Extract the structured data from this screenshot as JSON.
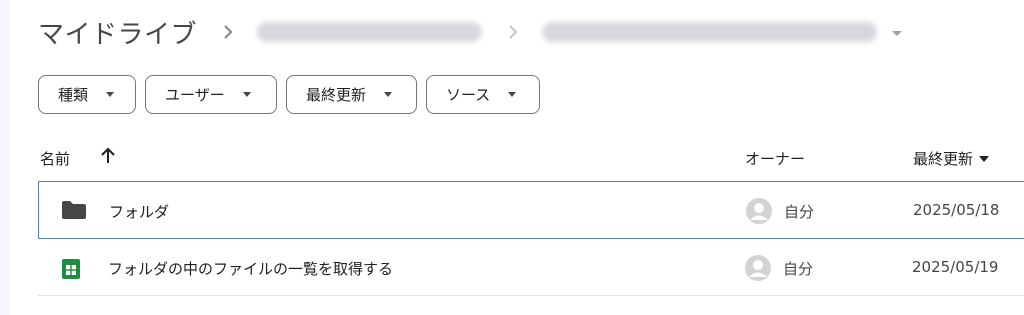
{
  "breadcrumb": {
    "root": "マイドライブ",
    "hidden_segments": 2
  },
  "filters": [
    {
      "label": "種類"
    },
    {
      "label": "ユーザー"
    },
    {
      "label": "最終更新"
    },
    {
      "label": "ソース"
    }
  ],
  "table": {
    "columns": {
      "name": "名前",
      "owner": "オーナー",
      "modified": "最終更新"
    },
    "sort": {
      "column": "name",
      "direction": "ascending"
    },
    "rows": [
      {
        "name": "フォルダ",
        "type": "folder-icon",
        "owner": "自分",
        "modified": "2025/05/18",
        "selected": true
      },
      {
        "name": "フォルダの中のファイルの一覧を取得する",
        "type": "google-sheets-icon",
        "owner": "自分",
        "modified": "2025/05/19",
        "selected": false
      }
    ]
  },
  "colors": {
    "accent_border": "#5a7db5",
    "sheets_green": "#1e8e3e",
    "folder_gray": "#444746"
  }
}
